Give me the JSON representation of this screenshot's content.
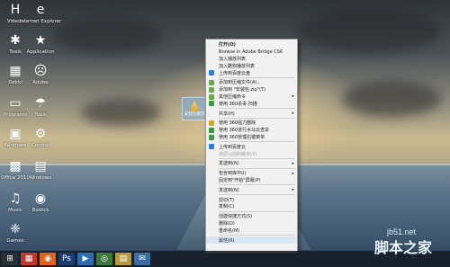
{
  "desktop_icons": [
    {
      "label": "Videos",
      "glyph": "H",
      "icon": "videos-icon"
    },
    {
      "label": "Internet Explorer",
      "glyph": "e",
      "icon": "ie-icon"
    },
    {
      "label": "Tools",
      "glyph": "✱",
      "icon": "tools-icon"
    },
    {
      "label": "Application",
      "glyph": "★",
      "icon": "application-icon"
    },
    {
      "label": "Dekki",
      "glyph": "▦",
      "icon": "dekki-icon"
    },
    {
      "label": "Adobe",
      "glyph": "☹",
      "icon": "adobe-icon"
    },
    {
      "label": "Programs",
      "glyph": "▭",
      "icon": "programs-icon"
    },
    {
      "label": "Tools",
      "glyph": "☂",
      "icon": "tools2-icon"
    },
    {
      "label": "Windows",
      "glyph": "▣",
      "icon": "windows-icon"
    },
    {
      "label": "Control",
      "glyph": "⚙",
      "icon": "control-icon"
    },
    {
      "label": "Office 2010",
      "glyph": "▩",
      "icon": "office-icon"
    },
    {
      "label": "Windows",
      "glyph": "▤",
      "icon": "windows2-icon"
    },
    {
      "label": "Music",
      "glyph": "♫",
      "icon": "music-icon"
    },
    {
      "label": "Bootck",
      "glyph": "◉",
      "icon": "bootck-icon"
    },
    {
      "label": "Games",
      "glyph": "❈",
      "icon": "games-icon"
    }
  ],
  "selected_file": {
    "label": "安装包提示"
  },
  "context_menu": {
    "items": [
      {
        "label": "打开(O)",
        "bold": true,
        "type": "item"
      },
      {
        "label": "Browse in Adobe Bridge CS6",
        "type": "item"
      },
      {
        "label": "加入播放列表",
        "type": "item"
      },
      {
        "label": "加入酷狗播放列表",
        "type": "item"
      },
      {
        "label": "上传到百度云盘",
        "icon_color": "#2c7fd6",
        "type": "item"
      },
      {
        "type": "sep"
      },
      {
        "label": "添加到压缩文件(A)...",
        "icon_color": "#6aa84f",
        "type": "item"
      },
      {
        "label": "添加到 \"安装包.zip\"(T)",
        "icon_color": "#6aa84f",
        "type": "item"
      },
      {
        "label": "其他压缩命令",
        "icon_color": "#6aa84f",
        "type": "item",
        "submenu": true
      },
      {
        "label": "使用 360杀毒 扫描",
        "icon_color": "#3a9c3a",
        "type": "item"
      },
      {
        "type": "sep"
      },
      {
        "label": "共享(H)",
        "type": "item",
        "submenu": true
      },
      {
        "type": "sep"
      },
      {
        "label": "使用 360强力删除",
        "icon_color": "#e0a020",
        "type": "item"
      },
      {
        "label": "使用 360进行木马云查杀",
        "icon_color": "#3a9c3a",
        "type": "item"
      },
      {
        "label": "使用 360管理右键菜单",
        "icon_color": "#3a9c3a",
        "type": "item"
      },
      {
        "type": "sep"
      },
      {
        "label": "上传到百度云",
        "icon_color": "#2c7fd6",
        "type": "item"
      },
      {
        "label": "还原以前的版本(V)",
        "disabled": true,
        "type": "item"
      },
      {
        "type": "sep"
      },
      {
        "label": "发送到(N)",
        "type": "item",
        "submenu": true
      },
      {
        "type": "sep"
      },
      {
        "label": "包含到库中(I)",
        "type": "item",
        "submenu": true
      },
      {
        "label": "固定到\"开始\"屏幕(P)",
        "type": "item"
      },
      {
        "type": "sep"
      },
      {
        "label": "发送到(N)",
        "type": "item",
        "submenu": true
      },
      {
        "type": "sep"
      },
      {
        "label": "剪切(T)",
        "type": "item"
      },
      {
        "label": "复制(C)",
        "type": "item"
      },
      {
        "type": "sep"
      },
      {
        "label": "创建快捷方式(S)",
        "type": "item"
      },
      {
        "label": "删除(D)",
        "type": "item"
      },
      {
        "label": "重命名(M)",
        "type": "item"
      },
      {
        "type": "sep"
      },
      {
        "label": "属性(R)",
        "type": "item",
        "highlighted": true
      }
    ]
  },
  "taskbar": [
    {
      "icon": "start-icon",
      "glyph": "⊞",
      "color": "#2a2f36"
    },
    {
      "icon": "windows-logo-icon",
      "glyph": "▦",
      "color": "#c0392b"
    },
    {
      "icon": "firefox-icon",
      "glyph": "◉",
      "color": "#e2621b"
    },
    {
      "icon": "photoshop-icon",
      "glyph": "Ps",
      "color": "#1a3c6e"
    },
    {
      "icon": "video-icon",
      "glyph": "▶",
      "color": "#2a6db0"
    },
    {
      "icon": "browser-icon",
      "glyph": "◎",
      "color": "#3b7a3b"
    },
    {
      "icon": "folder-icon",
      "glyph": "▤",
      "color": "#b89a3c"
    },
    {
      "icon": "mail-icon",
      "glyph": "✉",
      "color": "#3a6ea5"
    }
  ],
  "watermark": {
    "site": "jb51.net",
    "name": "脚本之家"
  }
}
